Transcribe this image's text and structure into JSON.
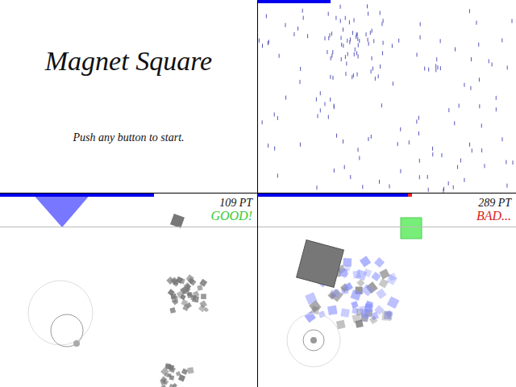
{
  "title_screen": {
    "title": "Magnet Square",
    "prompt": "Push any button to start."
  },
  "panels": [
    {
      "kind": "rain",
      "level": 0.28
    },
    {
      "kind": "play",
      "level": 0.6,
      "danger": 0,
      "score": "109 PT",
      "judgement": "GOOD!",
      "color": "#33cc33"
    },
    {
      "kind": "play",
      "level": 0.58,
      "danger": 0.016,
      "score": "289 PT",
      "judgement": "BAD...",
      "color": "#dd2222"
    }
  ]
}
